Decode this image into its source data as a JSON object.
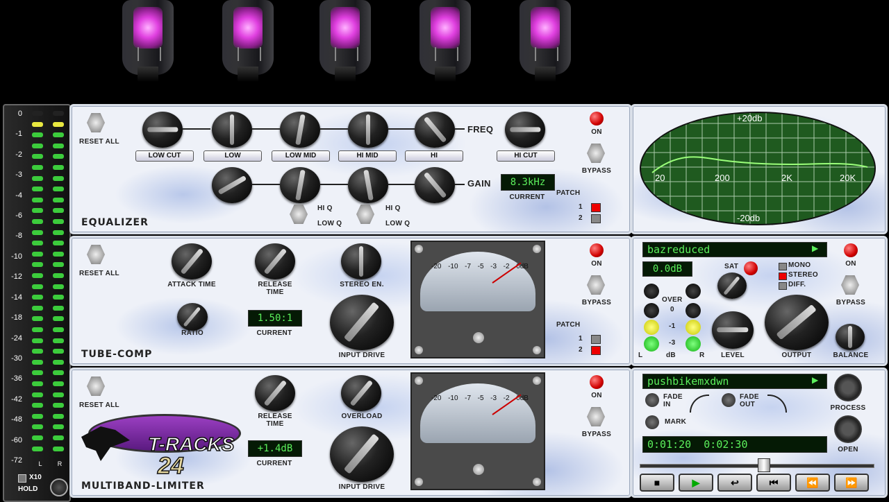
{
  "colors": {
    "lcd_text": "#5cf05c",
    "led_red": "#d00000",
    "tube_glow": "#e040e0",
    "scope_green": "#1f5a1f"
  },
  "meter_scale": [
    "0",
    "-1",
    "-2",
    "-3",
    "-4",
    "-6",
    "-8",
    "-10",
    "-12",
    "-14",
    "-18",
    "-24",
    "-30",
    "-36",
    "-42",
    "-48",
    "-60",
    "-72"
  ],
  "meter_channels": [
    "L",
    "R"
  ],
  "meter_hold": {
    "x10": "X10",
    "hold": "HOLD"
  },
  "equalizer": {
    "title": "EQUALIZER",
    "reset_all": "RESET ALL",
    "bands": [
      "LOW CUT",
      "LOW",
      "LOW MID",
      "HI MID",
      "HI",
      "HI CUT"
    ],
    "freq_label": "FREQ",
    "gain_label": "GAIN",
    "hi_q": "HI Q",
    "low_q": "LOW Q",
    "current_value": "8.3kHz",
    "current_label": "CURRENT",
    "on_label": "ON",
    "bypass_label": "BYPASS",
    "patch_label": "PATCH",
    "patch_options": [
      "1",
      "2"
    ]
  },
  "scope": {
    "top_label": "+20db",
    "bottom_label": "-20db",
    "freq_labels": [
      "20",
      "200",
      "2K",
      "20K"
    ]
  },
  "tube_comp": {
    "title": "TUBE-COMP",
    "reset_all": "RESET ALL",
    "attack_time": "ATTACK TIME",
    "release_time": "RELEASE TIME",
    "stereo_en": "STEREO EN.",
    "ratio": "RATIO",
    "current_value": "1.50:1",
    "current_label": "CURRENT",
    "input_drive": "INPUT DRIVE",
    "on_label": "ON",
    "bypass_label": "BYPASS",
    "patch_label": "PATCH",
    "patch_options": [
      "1",
      "2"
    ],
    "meter_scale": [
      "-20",
      "-10",
      "-7",
      "-5",
      "-3",
      "-2",
      "0dB"
    ]
  },
  "output_section": {
    "preset_name": "bazreduced",
    "level_value": "0.0dB",
    "sat_label": "SAT",
    "modes": [
      "MONO",
      "STEREO",
      "DIFF."
    ],
    "over_label": "OVER",
    "led_levels": [
      "0",
      "-1",
      "-3"
    ],
    "db_label": "dB",
    "left": "L",
    "right": "R",
    "level_label": "LEVEL",
    "output_label": "OUTPUT",
    "balance_label": "BALANCE",
    "on_label": "ON",
    "bypass_label": "BYPASS"
  },
  "limiter": {
    "title": "MULTIBAND-LIMITER",
    "reset_all": "RESET ALL",
    "release_time": "RELEASE TIME",
    "overload": "OVERLOAD",
    "current_value": "+1.4dB",
    "current_label": "CURRENT",
    "input_drive": "INPUT DRIVE",
    "on_label": "ON",
    "bypass_label": "BYPASS",
    "logo_line1": "T-RACKS",
    "logo_line2": "24"
  },
  "player": {
    "file_name": "pushbikemxdwn",
    "fade_in": "FADE IN",
    "fade_out": "FADE OUT",
    "mark": "MARK",
    "process": "PROCESS",
    "open": "OPEN",
    "time": "0:01:20  0:02:30",
    "position": 0.53,
    "transport": [
      "■",
      "▶",
      "↩",
      "⏮",
      "⏪",
      "⏩"
    ]
  }
}
